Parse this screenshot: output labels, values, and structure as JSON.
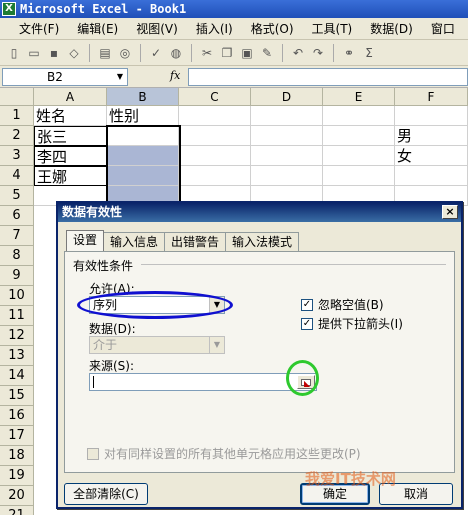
{
  "window": {
    "title": "Microsoft Excel - Book1",
    "app_icon": "excel-icon"
  },
  "menu": [
    "文件(F)",
    "编辑(E)",
    "视图(V)",
    "插入(I)",
    "格式(O)",
    "工具(T)",
    "数据(D)",
    "窗口"
  ],
  "toolbar": {
    "icons": [
      "new-icon",
      "open-icon",
      "save-icon",
      "permission-icon",
      "print-icon",
      "print-preview-icon",
      "spelling-icon",
      "research-icon",
      "cut-icon",
      "copy-icon",
      "paste-icon",
      "format-painter-icon",
      "undo-icon",
      "redo-icon",
      "hyperlink-icon",
      "autosum-icon"
    ]
  },
  "formula_bar": {
    "name_box": "B2",
    "fx": "fx",
    "content": ""
  },
  "sheet": {
    "columns": [
      "A",
      "B",
      "C",
      "D",
      "E",
      "F"
    ],
    "rows": [
      "1",
      "2",
      "3",
      "4",
      "5",
      "6",
      "7",
      "8",
      "9",
      "10",
      "11",
      "12",
      "13",
      "14",
      "15",
      "16",
      "17",
      "18",
      "19",
      "20",
      "21"
    ],
    "cells": {
      "A1": "姓名",
      "B1": "性别",
      "A2": "张三",
      "A3": "李四",
      "A4": "王娜",
      "F2": "男",
      "F3": "女"
    }
  },
  "dialog": {
    "title": "数据有效性",
    "close": "×",
    "tabs": [
      "设置",
      "输入信息",
      "出错警告",
      "输入法模式"
    ],
    "active_tab": "设置",
    "section": "有效性条件",
    "allow_label": "允许(A):",
    "allow_value": "序列",
    "data_label": "数据(D):",
    "data_value": "介于",
    "ignore_blank": {
      "label": "忽略空值(B)",
      "checked": true
    },
    "dropdown_arrow": {
      "label": "提供下拉箭头(I)",
      "checked": true
    },
    "source_label": "来源(S):",
    "source_value": "",
    "apply_all": {
      "label": "对有同样设置的所有其他单元格应用这些更改(P)",
      "checked": false
    },
    "clear_all_button": "全部清除(C)",
    "ok_button": "确定",
    "cancel_button": "取消"
  },
  "annotation_colors": {
    "blue_ring": "#1010d0",
    "green_ring": "#2ec92e"
  },
  "watermark": "我爱IT技术网"
}
